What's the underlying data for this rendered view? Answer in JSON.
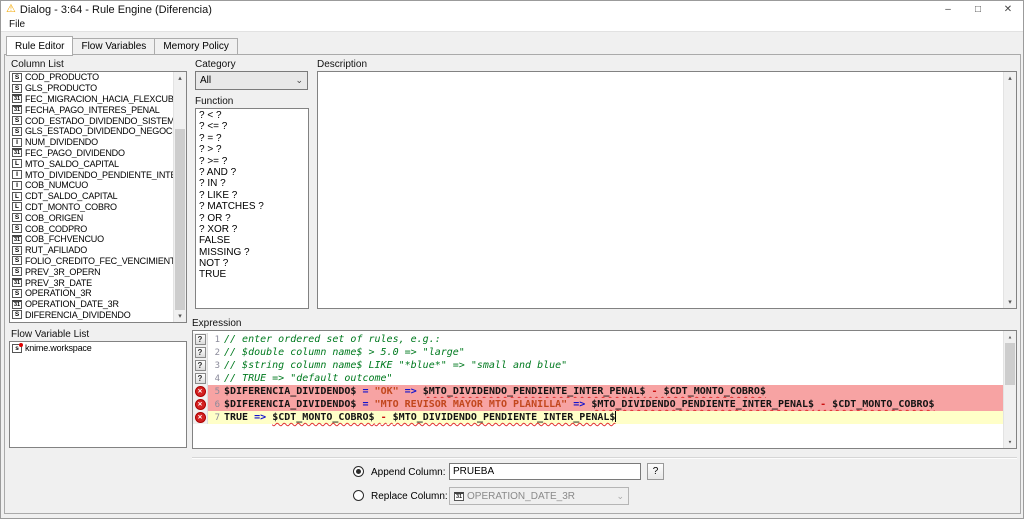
{
  "window": {
    "title": "Dialog - 3:64 - Rule Engine (Diferencia)",
    "warning_glyph": "⚠",
    "minimize_glyph": "–",
    "maximize_glyph": "□",
    "close_glyph": "✕"
  },
  "menu": {
    "items": [
      "File"
    ]
  },
  "tabs": [
    {
      "label": "Rule Editor",
      "active": true
    },
    {
      "label": "Flow Variables",
      "active": false
    },
    {
      "label": "Memory Policy",
      "active": false
    }
  ],
  "column_list": {
    "label": "Column List",
    "items": [
      {
        "type": "S",
        "name": "COD_PRODUCTO"
      },
      {
        "type": "S",
        "name": "GLS_PRODUCTO"
      },
      {
        "type": "31",
        "name": "FEC_MIGRACION_HACIA_FLEXCUBE"
      },
      {
        "type": "31",
        "name": "FECHA_PAGO_INTERES_PENAL"
      },
      {
        "type": "S",
        "name": "COD_ESTADO_DIVIDENDO_SISTEMA"
      },
      {
        "type": "S",
        "name": "GLS_ESTADO_DIVIDENDO_NEGOCIO"
      },
      {
        "type": "I",
        "name": "NUM_DIVIDENDO"
      },
      {
        "type": "31",
        "name": "FEC_PAGO_DIVIDENDO"
      },
      {
        "type": "L",
        "name": "MTO_SALDO_CAPITAL"
      },
      {
        "type": "I",
        "name": "MTO_DIVIDENDO_PENDIENTE_INTER_PENAL"
      },
      {
        "type": "I",
        "name": "COB_NUMCUO"
      },
      {
        "type": "L",
        "name": "CDT_SALDO_CAPITAL"
      },
      {
        "type": "L",
        "name": "CDT_MONTO_COBRO"
      },
      {
        "type": "S",
        "name": "COB_ORIGEN"
      },
      {
        "type": "S",
        "name": "COB_CODPRO"
      },
      {
        "type": "31",
        "name": "COB_FCHVENCUO"
      },
      {
        "type": "S",
        "name": "RUT_AFILIADO"
      },
      {
        "type": "S",
        "name": "FOLIO_CREDITO_FEC_VENCIMIENTO"
      },
      {
        "type": "S",
        "name": "PREV_3R_OPERN"
      },
      {
        "type": "31",
        "name": "PREV_3R_DATE"
      },
      {
        "type": "S",
        "name": "OPERATION_3R"
      },
      {
        "type": "31",
        "name": "OPERATION_DATE_3R"
      },
      {
        "type": "S",
        "name": "DIFERENCIA_DIVIDENDO"
      }
    ]
  },
  "flow_variable_list": {
    "label": "Flow Variable List",
    "items": [
      {
        "type": "s",
        "name": "knime.workspace"
      }
    ]
  },
  "category": {
    "label": "Category",
    "value": "All"
  },
  "function_list": {
    "label": "Function",
    "items": [
      "? < ?",
      "? <= ?",
      "? = ?",
      "? > ?",
      "? >= ?",
      "? AND ?",
      "? IN ?",
      "? LIKE ?",
      "? MATCHES ?",
      "? OR ?",
      "? XOR ?",
      "FALSE",
      "MISSING ?",
      "NOT ?",
      "TRUE"
    ]
  },
  "description": {
    "label": "Description",
    "content": ""
  },
  "expression": {
    "label": "Expression",
    "lines": [
      {
        "num": "1",
        "gutter": "help",
        "bg": "",
        "tokens": [
          {
            "t": "// enter ordered set of rules, e.g.:",
            "s": "comment"
          }
        ]
      },
      {
        "num": "2",
        "gutter": "help",
        "bg": "",
        "tokens": [
          {
            "t": "// $double column name$ > 5.0 => \"large\"",
            "s": "comment"
          }
        ]
      },
      {
        "num": "3",
        "gutter": "help",
        "bg": "",
        "tokens": [
          {
            "t": "// $string column name$ LIKE \"*blue*\" => \"small and blue\"",
            "s": "comment"
          }
        ]
      },
      {
        "num": "4",
        "gutter": "help",
        "bg": "",
        "tokens": [
          {
            "t": "// TRUE => \"default outcome\"",
            "s": "comment"
          }
        ]
      },
      {
        "num": "5",
        "gutter": "error",
        "bg": "pink",
        "tokens": [
          {
            "t": "$DIFERENCIA_DIVIDENDO$",
            "s": "col"
          },
          {
            "t": " ",
            "s": ""
          },
          {
            "t": "=",
            "s": "op"
          },
          {
            "t": " ",
            "s": ""
          },
          {
            "t": "\"OK\"",
            "s": "str"
          },
          {
            "t": " ",
            "s": ""
          },
          {
            "t": "=>",
            "s": "op"
          },
          {
            "t": " ",
            "s": ""
          },
          {
            "t": "$MTO_DIVIDENDO_PENDIENTE_INTER_PENAL$",
            "s": "col err"
          },
          {
            "t": " ",
            "s": "err"
          },
          {
            "t": "-",
            "s": "minus err"
          },
          {
            "t": " ",
            "s": "err"
          },
          {
            "t": "$CDT_MONTO_COBRO$",
            "s": "col err"
          }
        ]
      },
      {
        "num": "6",
        "gutter": "error",
        "bg": "pink",
        "tokens": [
          {
            "t": "$DIFERENCIA_DIVIDENDO$",
            "s": "col"
          },
          {
            "t": " ",
            "s": ""
          },
          {
            "t": "=",
            "s": "op"
          },
          {
            "t": " ",
            "s": ""
          },
          {
            "t": "\"MTO REVISOR MAYOR MTO PLANILLA\"",
            "s": "str"
          },
          {
            "t": " ",
            "s": ""
          },
          {
            "t": "=>",
            "s": "op"
          },
          {
            "t": " ",
            "s": ""
          },
          {
            "t": "$MTO_DIVIDENDO_PENDIENTE_INTER_PENAL$",
            "s": "col err"
          },
          {
            "t": " ",
            "s": "err"
          },
          {
            "t": "-",
            "s": "minus err"
          },
          {
            "t": " ",
            "s": "err"
          },
          {
            "t": "$CDT_MONTO_COBRO$",
            "s": "col err"
          }
        ]
      },
      {
        "num": "7",
        "gutter": "error",
        "bg": "yellow",
        "cursor": true,
        "tokens": [
          {
            "t": "TRUE",
            "s": "kw"
          },
          {
            "t": " ",
            "s": ""
          },
          {
            "t": "=>",
            "s": "op"
          },
          {
            "t": " ",
            "s": ""
          },
          {
            "t": "$CDT_MONTO_COBRO$",
            "s": "col err"
          },
          {
            "t": " ",
            "s": "err"
          },
          {
            "t": "-",
            "s": "minus err"
          },
          {
            "t": " ",
            "s": "err"
          },
          {
            "t": "$MTO_DIVIDENDO_PENDIENTE_INTER_PENAL$",
            "s": "col err"
          }
        ]
      }
    ]
  },
  "output": {
    "append_label": "Append Column:",
    "append_value": "PRUEBA",
    "help_glyph": "?",
    "replace_label": "Replace Column:",
    "replace_value": "OPERATION_DATE_3R",
    "replace_type": "31"
  },
  "colors": {
    "rule_error_bg": "#f7a3a3",
    "active_line_bg": "#ffffc8",
    "comment_green": "#007a1f",
    "operator_blue": "#1414cc",
    "string_orange": "#c2471d",
    "error_red": "#e03030",
    "warning_yellow": "#f2a700"
  }
}
